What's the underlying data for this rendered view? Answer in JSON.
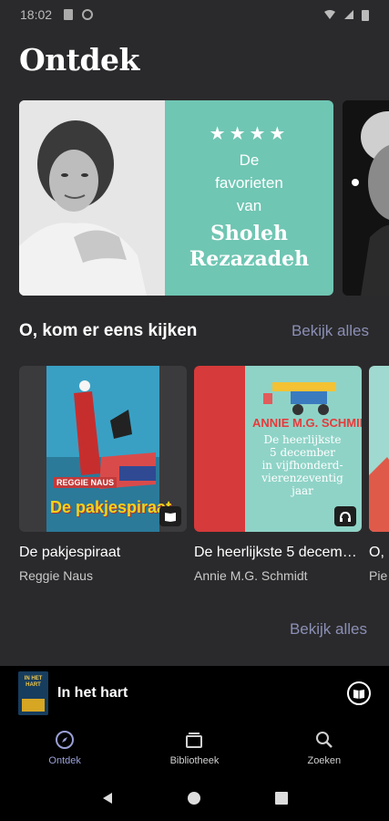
{
  "status_bar": {
    "time": "18:02"
  },
  "header": {
    "title": "Ontdek"
  },
  "hero": {
    "stars": "★★★★",
    "subtitle_line1": "De",
    "subtitle_line2": "favorieten",
    "subtitle_line3": "van",
    "name_line1": "Sholeh",
    "name_line2": "Rezazadeh",
    "panel_color": "#6fc6b3"
  },
  "section": {
    "title": "O, kom er eens kijken",
    "see_all": "Bekijk alles",
    "books": [
      {
        "title": "De pakjespiraat",
        "author": "Reggie Naus",
        "cover_author": "REGGIE NAUS",
        "cover_title": "De pakjespiraat",
        "format_icon": "book-icon"
      },
      {
        "title": "De heerlijkste 5 december in vijfhonderd-vierenzeventig jaar",
        "author": "Annie M.G. Schmidt",
        "cover_author": "ANNIE M.G. SCHMIDT",
        "cover_title_1": "De heerlijkste",
        "cover_title_2": "5 december",
        "cover_title_3": "in vijfhonderd-",
        "cover_title_4": "vierenzeventig",
        "cover_title_5": "jaar",
        "format_icon": "headphones-icon"
      },
      {
        "title": "O, k",
        "author": "Pie"
      }
    ]
  },
  "section2": {
    "see_all": "Bekijk alles"
  },
  "mini_player": {
    "title": "In het hart",
    "cover_text": "IN HET HART"
  },
  "tabs": [
    {
      "label": "Ontdek",
      "icon": "compass-icon",
      "active": true
    },
    {
      "label": "Bibliotheek",
      "icon": "library-icon",
      "active": false
    },
    {
      "label": "Zoeken",
      "icon": "search-icon",
      "active": false
    }
  ]
}
